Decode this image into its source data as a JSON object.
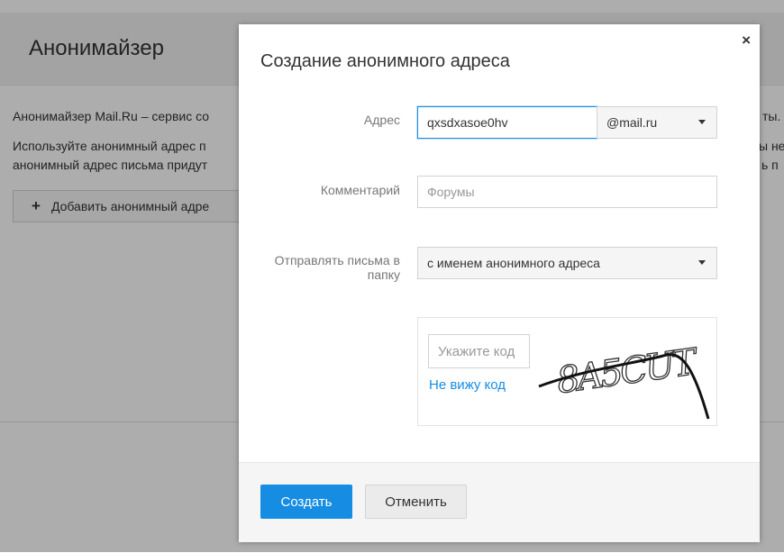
{
  "background": {
    "title": "Анонимайзер",
    "intro_left": "Анонимайзер Mail.Ru – сервис со",
    "intro_right": "ты.",
    "usage_line1_left": "Используйте анонимный адрес п",
    "usage_line1_right": "ы не",
    "usage_line2_left": "анонимный адрес письма придут",
    "usage_line2_right": "ь п",
    "add_button": "Добавить анонимный адре"
  },
  "modal": {
    "title": "Создание анонимного адреса",
    "close_glyph": "×",
    "address": {
      "label": "Адрес",
      "value": "qxsdxasoe0hv",
      "domain": "@mail.ru"
    },
    "comment": {
      "label": "Комментарий",
      "placeholder": "Форумы"
    },
    "folder": {
      "label": "Отправлять письма в папку",
      "value": "с именем анонимного адреса"
    },
    "captcha": {
      "placeholder": "Укажите код",
      "link": "Не вижу код",
      "code": "8A5CUT"
    },
    "footer": {
      "create_label": "Создать",
      "cancel_label": "Отменить"
    }
  },
  "colors": {
    "accent": "#168de2",
    "overlay": "#000000"
  }
}
